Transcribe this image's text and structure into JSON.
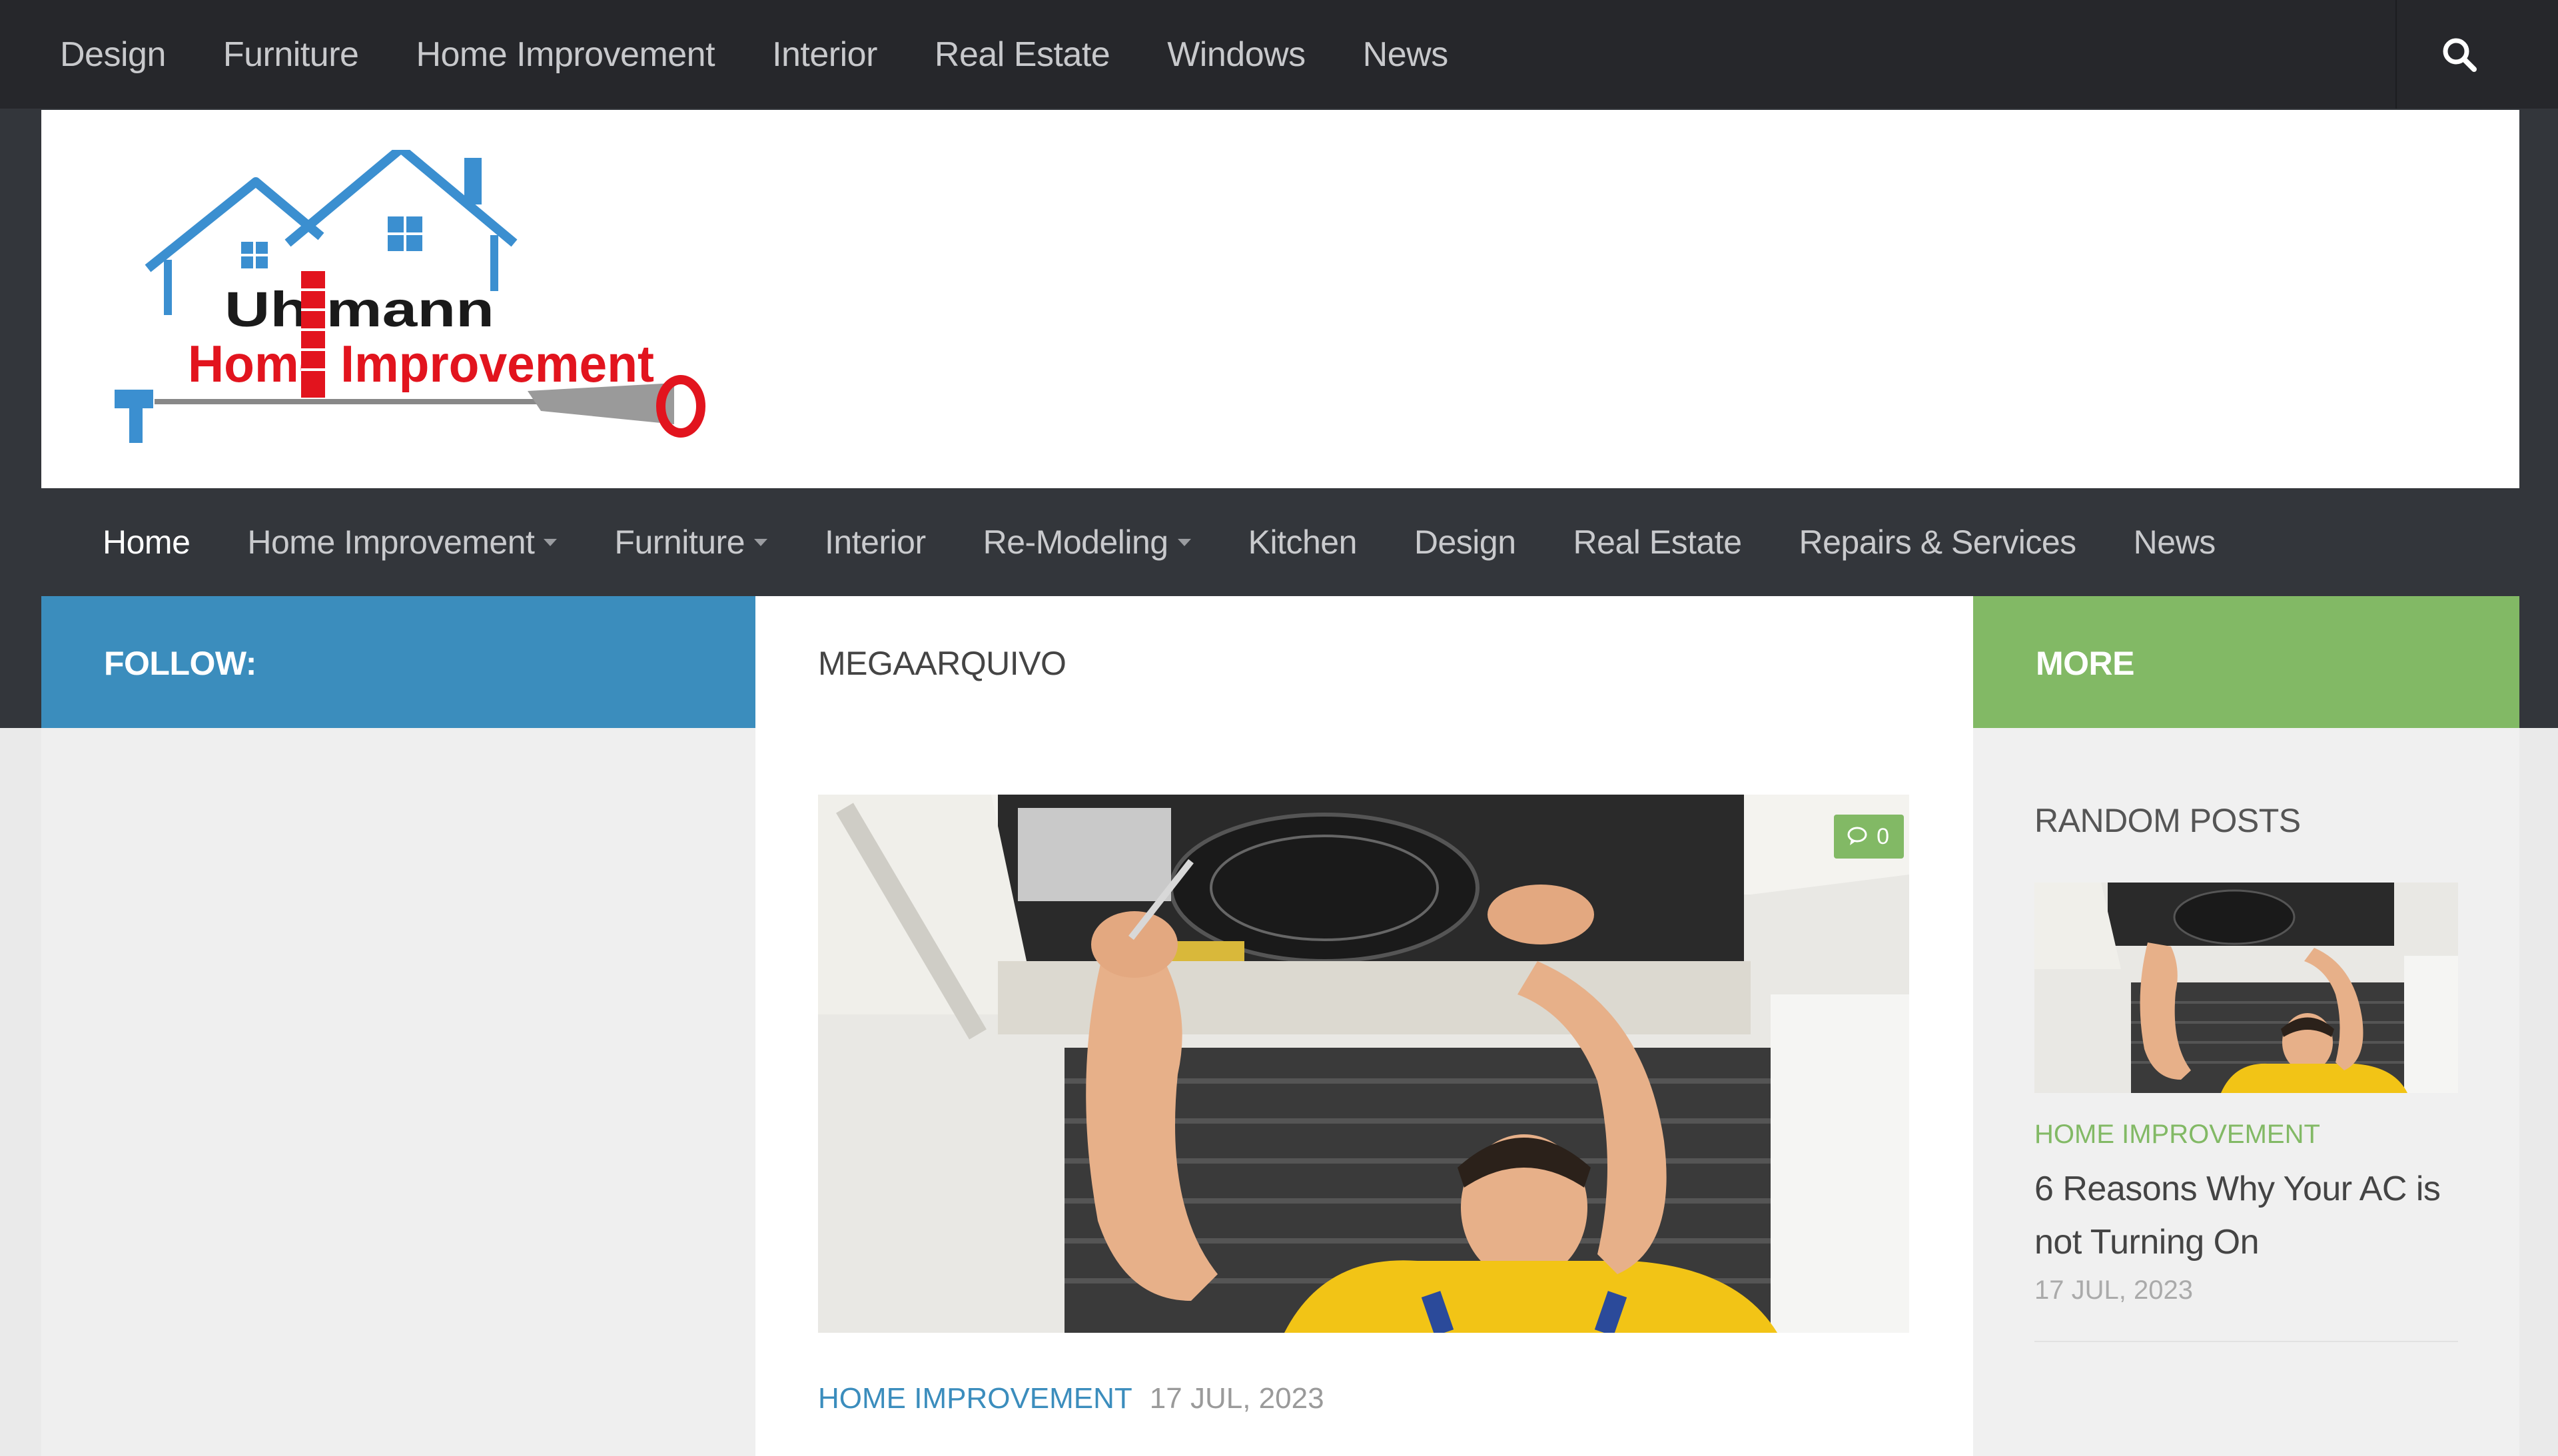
{
  "top_nav": {
    "items": [
      "Design",
      "Furniture",
      "Home Improvement",
      "Interior",
      "Real Estate",
      "Windows",
      "News"
    ]
  },
  "logo": {
    "line1": "Uhlmann",
    "line2": "Home Improvement",
    "colors": {
      "house": "#3b8fd0",
      "text_dark": "#1a1a1a",
      "text_red": "#e2141e"
    }
  },
  "main_nav": {
    "items": [
      {
        "label": "Home",
        "dropdown": false
      },
      {
        "label": "Home Improvement",
        "dropdown": true
      },
      {
        "label": "Furniture",
        "dropdown": true
      },
      {
        "label": "Interior",
        "dropdown": false
      },
      {
        "label": "Re-Modeling",
        "dropdown": true
      },
      {
        "label": "Kitchen",
        "dropdown": false
      },
      {
        "label": "Design",
        "dropdown": false
      },
      {
        "label": "Real Estate",
        "dropdown": false
      },
      {
        "label": "Repairs & Services",
        "dropdown": false
      },
      {
        "label": "News",
        "dropdown": false
      }
    ]
  },
  "sections": {
    "follow": "FOLLOW:",
    "main": "MEGAARQUIVO",
    "more": "MORE"
  },
  "featured_post": {
    "comment_count": "0",
    "category": "HOME IMPROVEMENT",
    "date": "17 JUL, 2023"
  },
  "random_posts": {
    "title": "RANDOM POSTS",
    "post": {
      "category": "HOME IMPROVEMENT",
      "title": "6 Reasons Why Your AC is not Turning On",
      "date": "17 JUL, 2023"
    }
  },
  "colors": {
    "topbar": "#26272b",
    "nav": "#33363b",
    "follow": "#3b8dbd",
    "more": "#82b965",
    "category": "#3b8dbd"
  },
  "icons": [
    "search-icon",
    "comment-icon",
    "chevron-down-icon"
  ]
}
